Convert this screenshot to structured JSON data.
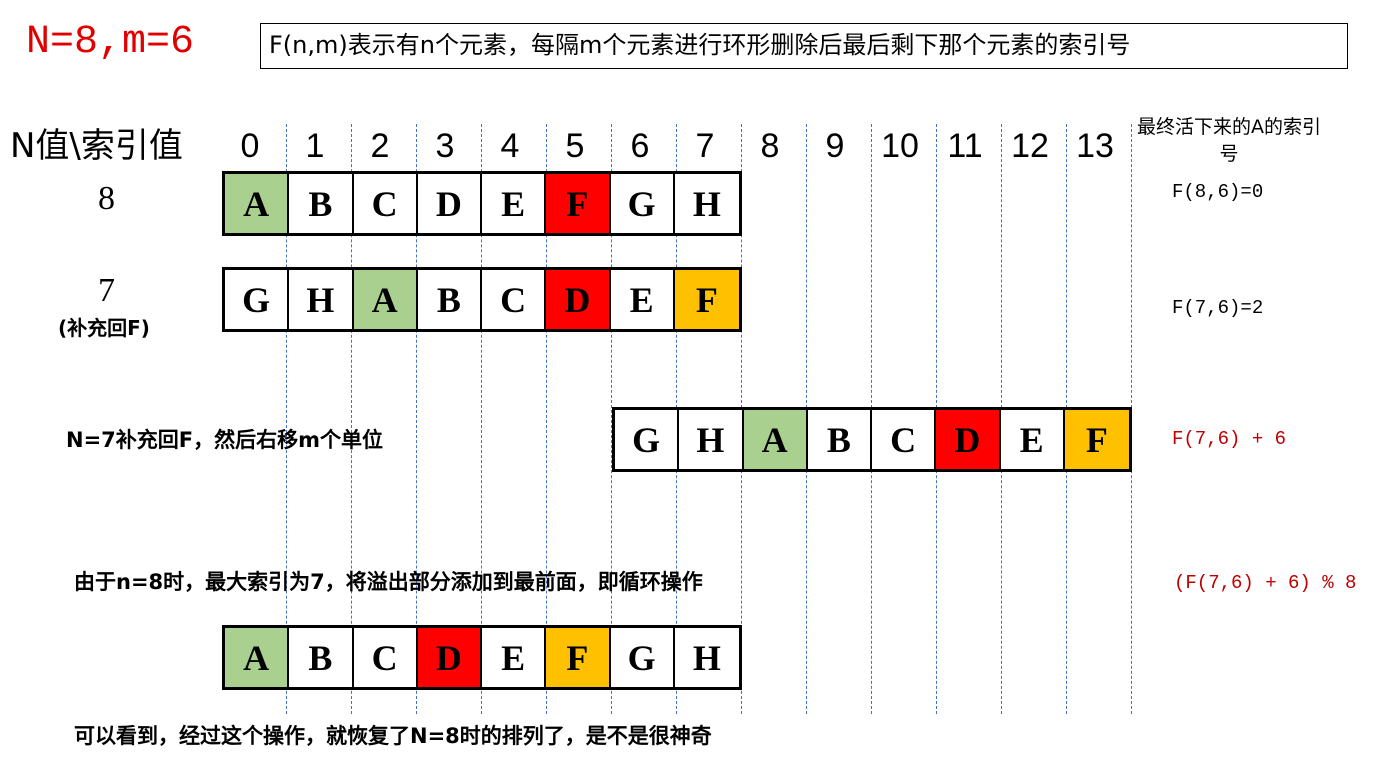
{
  "title": "N=8,m=6",
  "definition": "F(n,m)表示有n个元素，每隔m个元素进行环形删除后最后剩下那个元素的索引号",
  "header_label": "N值\\索引值",
  "index_labels": [
    "0",
    "1",
    "2",
    "3",
    "4",
    "5",
    "6",
    "7",
    "8",
    "9",
    "10",
    "11",
    "12",
    "13"
  ],
  "result_header": "最终活下来的A的索引号",
  "colors": {
    "green": "#a9d08e",
    "red": "#ff0000",
    "orange": "#ffc000",
    "white": "#ffffff",
    "accent_text": "#c00000",
    "grid": "#4472c4"
  },
  "rows": [
    {
      "label": "8",
      "sublabel": "",
      "start_index": 0,
      "cells": [
        {
          "t": "A",
          "c": "green"
        },
        {
          "t": "B",
          "c": "white"
        },
        {
          "t": "C",
          "c": "white"
        },
        {
          "t": "D",
          "c": "white"
        },
        {
          "t": "E",
          "c": "white"
        },
        {
          "t": "F",
          "c": "red"
        },
        {
          "t": "G",
          "c": "white"
        },
        {
          "t": "H",
          "c": "white"
        }
      ],
      "formula": "F(8,6)=0",
      "formula_color": "black"
    },
    {
      "label": "7",
      "sublabel": "(补充回F)",
      "start_index": 0,
      "cells": [
        {
          "t": "G",
          "c": "white"
        },
        {
          "t": "H",
          "c": "white"
        },
        {
          "t": "A",
          "c": "green"
        },
        {
          "t": "B",
          "c": "white"
        },
        {
          "t": "C",
          "c": "white"
        },
        {
          "t": "D",
          "c": "red"
        },
        {
          "t": "E",
          "c": "white"
        },
        {
          "t": "F",
          "c": "orange"
        }
      ],
      "formula": "F(7,6)=2",
      "formula_color": "black"
    },
    {
      "label": "",
      "sublabel": "",
      "start_index": 6,
      "cells": [
        {
          "t": "G",
          "c": "white"
        },
        {
          "t": "H",
          "c": "white"
        },
        {
          "t": "A",
          "c": "green"
        },
        {
          "t": "B",
          "c": "white"
        },
        {
          "t": "C",
          "c": "white"
        },
        {
          "t": "D",
          "c": "red"
        },
        {
          "t": "E",
          "c": "white"
        },
        {
          "t": "F",
          "c": "orange"
        }
      ],
      "formula": "F(7,6) + 6",
      "formula_color": "accent"
    },
    {
      "label": "",
      "sublabel": "",
      "start_index": 0,
      "cells": [
        {
          "t": "A",
          "c": "green"
        },
        {
          "t": "B",
          "c": "white"
        },
        {
          "t": "C",
          "c": "white"
        },
        {
          "t": "D",
          "c": "red"
        },
        {
          "t": "E",
          "c": "white"
        },
        {
          "t": "F",
          "c": "orange"
        },
        {
          "t": "G",
          "c": "white"
        },
        {
          "t": "H",
          "c": "white"
        }
      ],
      "formula": "",
      "formula_color": "black"
    }
  ],
  "notes": {
    "shift": "N=7补充回F，然后右移m个单位",
    "wrap": "由于n=8时，最大索引为7，将溢出部分添加到最前面，即循环操作",
    "wrap_formula": "(F(7,6) + 6) % 8",
    "conclusion": "可以看到，经过这个操作，就恢复了N=8时的排列了，是不是很神奇"
  }
}
